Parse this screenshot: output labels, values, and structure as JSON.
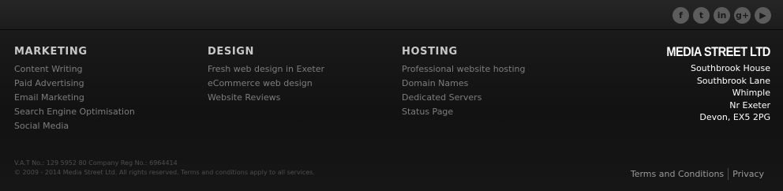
{
  "social": {
    "icons": [
      "facebook-icon",
      "twitter-icon",
      "linkedin-icon",
      "googleplus-icon",
      "youtube-icon"
    ],
    "glyphs": [
      "f",
      "t",
      "in",
      "g+",
      "▶"
    ]
  },
  "marketing": {
    "heading": "MARKETING",
    "items": [
      "Content Writing",
      "Paid Advertising",
      "Email Marketing",
      "Search Engine Optimisation",
      "Social Media"
    ]
  },
  "design": {
    "heading": "DESIGN",
    "items": [
      "Fresh web design in Exeter",
      "eCommerce web design",
      "Website Reviews"
    ]
  },
  "hosting": {
    "heading": "HOSTING",
    "items": [
      "Professional website hosting",
      "Domain Names",
      "Dedicated Servers",
      "Status Page"
    ]
  },
  "brand": {
    "name": "MEDIA STREET LTD",
    "address": [
      "Southbrook House",
      "Southbrook Lane",
      "Whimple",
      "Nr Exeter",
      "Devon, EX5 2PG"
    ]
  },
  "legal": {
    "vat": "V.A.T No.: 129 5952 80 Company Reg No.: 6964414",
    "copyright": "© 2009 - 2014 Media Street Ltd. All rights reserved. Terms and conditions apply to all services."
  },
  "bottom_links": {
    "terms": "Terms and Conditions",
    "privacy": "Privacy"
  }
}
